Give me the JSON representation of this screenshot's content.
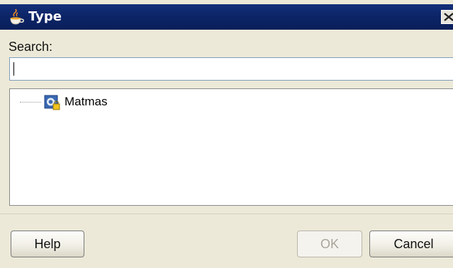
{
  "window": {
    "title": "Type",
    "close_glyph": "×"
  },
  "search": {
    "label": "Search:",
    "value": "",
    "placeholder": ""
  },
  "tree": {
    "items": [
      {
        "label": "Matmas",
        "icon": "schema-element-icon"
      }
    ]
  },
  "buttons": {
    "help": "Help",
    "ok": "OK",
    "cancel": "Cancel"
  },
  "colors": {
    "titlebar": "#0c2466",
    "dialog_background": "#ece9d8",
    "input_border": "#7f9db9"
  }
}
